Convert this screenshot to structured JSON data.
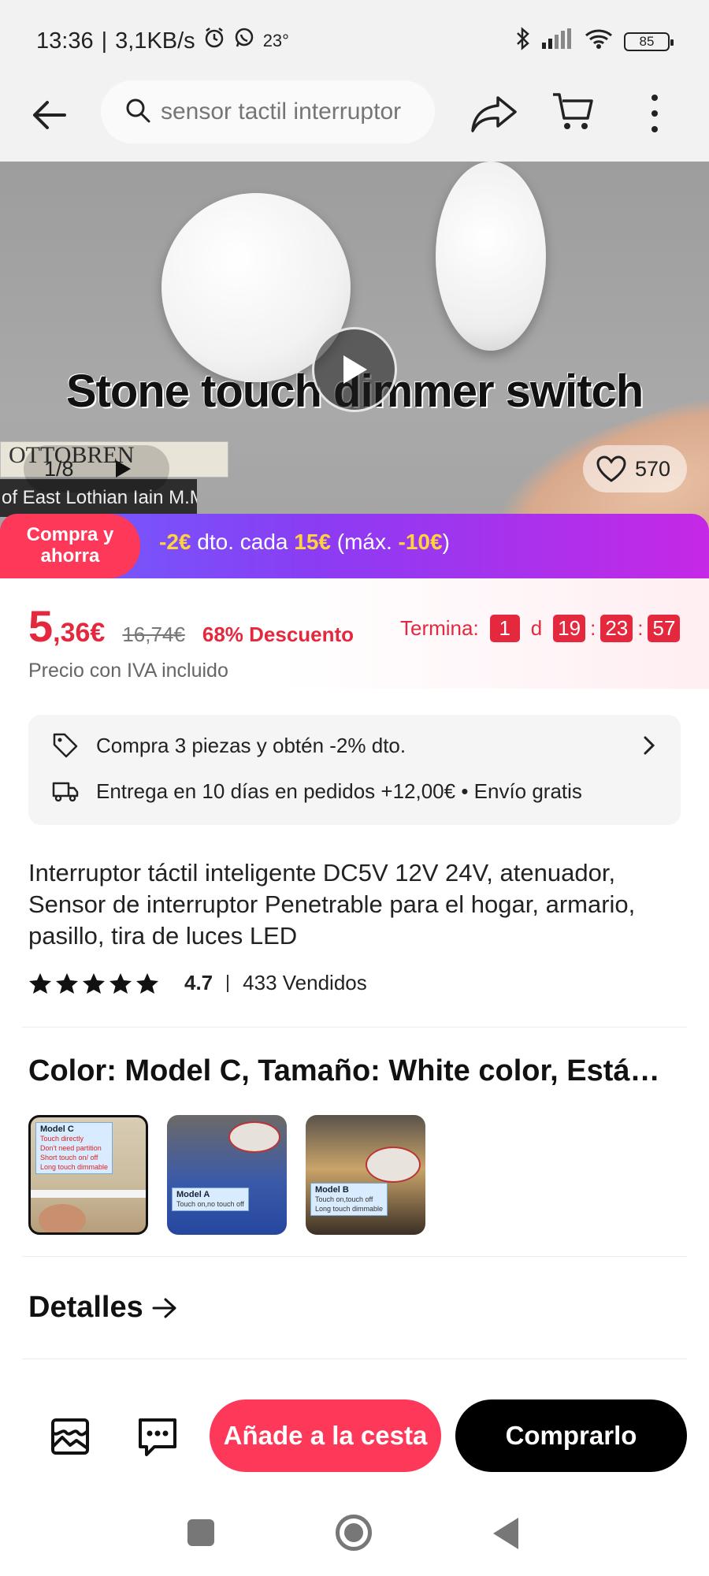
{
  "status_bar": {
    "time": "13:36",
    "separator": "|",
    "speed": "3,1KB/s",
    "temperature": "23°",
    "battery": "85"
  },
  "nav": {
    "search_placeholder": "sensor tactil interruptor"
  },
  "hero": {
    "caption": "Stone touch dimmer switch",
    "media_counter": "1/8",
    "favorites": "570",
    "book1_text": "OTTOBREN",
    "book2_text": "of East Lothian  Iain M.M. Johnstone"
  },
  "promo": {
    "tag": "Compra y ahorra",
    "text_prefix": "-",
    "amount": "2€",
    "text_mid": " dto. cada ",
    "threshold": "15€",
    "text_max": " (máx. ",
    "max_amount": "-10€",
    "text_end": ")"
  },
  "price": {
    "integer": "5",
    "decimal": ",36€",
    "original": "16,74€",
    "discount": "68% Descuento",
    "tax_note": "Precio con IVA incluido",
    "countdown_label": "Termina:",
    "days": "1",
    "days_unit": "d",
    "hours": "19",
    "minutes": "23",
    "seconds": "57"
  },
  "info": {
    "offer": "Compra 3 piezas y obtén -2% dto.",
    "delivery": "Entrega en 10 días en pedidos +12,00€ • Envío gratis"
  },
  "product": {
    "title": "Interruptor táctil inteligente DC5V 12V 24V, atenuador, Sensor de interruptor Penetrable para el hogar, armario, pasillo, tira de luces LED",
    "rating": "4.7",
    "sold": "433 Vendidos",
    "stars": 5
  },
  "variants": {
    "title": "Color: Model C, Tamaño: White color, Está…",
    "items": [
      {
        "label": "Model C",
        "line1": "Touch directly",
        "line2": "Don't need partition",
        "line3": "Short touch on/ off",
        "line4": "Long touch dimmable"
      },
      {
        "label": "Model A",
        "line1": "Touch on,no touch off"
      },
      {
        "label": "Model B",
        "line1": "Touch on,touch off",
        "line2": "Long touch dimmable"
      }
    ]
  },
  "details": {
    "label": "Detalles"
  },
  "actions": {
    "add_to_cart": "Añade a la cesta",
    "buy_now": "Comprarlo"
  },
  "colors": {
    "accent": "#fd3859",
    "price_red": "#e4293f",
    "promo_gradient_start": "#6b63ff",
    "promo_gradient_end": "#c528e6",
    "highlight_yellow": "#ffd33d"
  }
}
